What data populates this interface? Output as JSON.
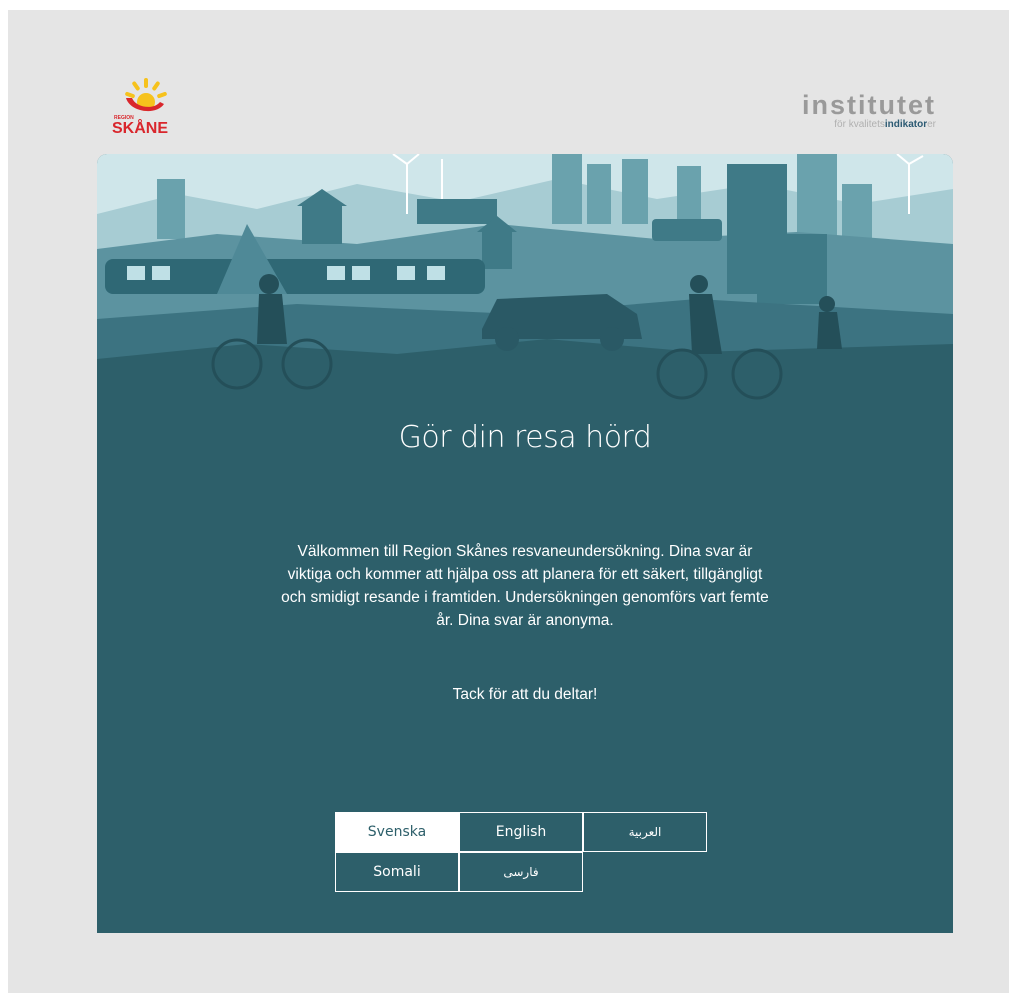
{
  "logos": {
    "left_brand": "SKÅNE",
    "left_brand_small": "REGION",
    "right_brand": "institutet",
    "right_tagline_pre": "för kvalitets",
    "right_tagline_bold": "indikator",
    "right_tagline_post": "er"
  },
  "survey": {
    "title": "Gör din resa hörd",
    "intro": "Välkommen till Region Skånes resvaneundersökning. Dina svar är viktiga och kommer att hjälpa oss att planera för ett säkert, tillgängligt och smidigt resande i framtiden. Undersökningen genomförs vart femte år. Dina svar är anonyma.",
    "thanks": "Tack för att du deltar!"
  },
  "languages": [
    {
      "label": "Svenska",
      "selected": true
    },
    {
      "label": "English",
      "selected": false
    },
    {
      "label": "العربية",
      "selected": false
    },
    {
      "label": "Somali",
      "selected": false
    },
    {
      "label": "فارسی",
      "selected": false
    }
  ],
  "colors": {
    "card_bg": "#2d5f6a",
    "page_bg": "#e5e5e5",
    "brand_red": "#d9262c",
    "brand_yellow": "#f6c21c"
  },
  "icons": {
    "header_illustration": "city-transport-illustration",
    "left_logo": "region-skane-logo",
    "right_logo": "institutet-logo"
  }
}
